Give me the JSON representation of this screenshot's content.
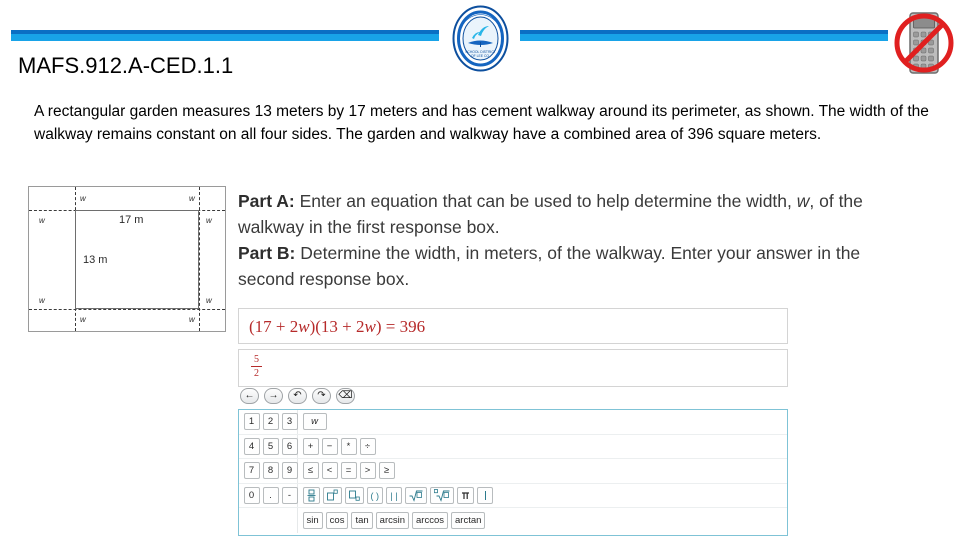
{
  "header": {
    "title": "MAFS.912.A-CED.1.1",
    "logo_name": "school-seal-logo",
    "no_calculator_name": "no-calculator-icon",
    "rule_color_top": "#0b6fc4",
    "rule_color_bottom": "#18a3e8"
  },
  "stem": {
    "text": "A rectangular garden measures 13 meters by 17 meters and has cement walkway around its perimeter, as shown. The width of the walkway remains constant on all four sides. The garden and walkway have a combined area of 396 square meters."
  },
  "figure": {
    "width_label": "17 m",
    "height_label": "13 m",
    "walkway_label": "w",
    "corner_labels": [
      "w",
      "w",
      "w",
      "w",
      "w",
      "w",
      "w",
      "w"
    ]
  },
  "parts": {
    "part_a_label": "Part A:",
    "part_a_text_1": " Enter an equation that can be used to help determine the width, ",
    "part_a_var": "w",
    "part_a_text_2": ", of the walkway in the first response box.",
    "part_b_label": "Part B:",
    "part_b_text": " Determine the width, in meters, of the walkway. Enter your answer in the second response box."
  },
  "responses": {
    "box1_value": "(17 + 2w)(13 + 2w) = 396",
    "box1_prefix": "(17 + 2",
    "box1_var1": "w",
    "box1_mid": ")(13 + 2",
    "box1_var2": "w",
    "box1_suffix": ") = 396",
    "box2_numerator": "5",
    "box2_denominator": "2",
    "answer_color": "#b62a2a"
  },
  "navbar": {
    "buttons": [
      {
        "name": "move-left-button",
        "glyph": "←"
      },
      {
        "name": "move-right-button",
        "glyph": "→"
      },
      {
        "name": "undo-button",
        "glyph": "↶"
      },
      {
        "name": "redo-button",
        "glyph": "↷"
      },
      {
        "name": "backspace-button",
        "glyph": "⌫"
      }
    ]
  },
  "keypad": {
    "border_color": "#7fc3d6",
    "rows": [
      {
        "groups": [
          {
            "keys": [
              "1",
              "2",
              "3"
            ]
          },
          {
            "keys": [
              "w"
            ],
            "italic": true
          }
        ]
      },
      {
        "groups": [
          {
            "keys": [
              "4",
              "5",
              "6"
            ]
          },
          {
            "keys": [
              "+",
              "−",
              "*",
              "÷"
            ]
          }
        ]
      },
      {
        "groups": [
          {
            "keys": [
              "7",
              "8",
              "9"
            ]
          },
          {
            "keys": [
              "≤",
              "<",
              "=",
              ">",
              "≥"
            ]
          }
        ]
      },
      {
        "groups": [
          {
            "keys": [
              "0",
              ".",
              "-"
            ]
          },
          {
            "keys": [
              "fraction",
              "exponent",
              "subscript",
              "parentheses",
              "absolute-value",
              "square-root",
              "nth-root",
              "pi",
              "vertical-bar"
            ],
            "template": true
          }
        ]
      },
      {
        "groups": [
          {
            "keys": []
          },
          {
            "keys": [
              "sin",
              "cos",
              "tan",
              "arcsin",
              "arccos",
              "arctan"
            ],
            "fn": true
          }
        ]
      }
    ]
  }
}
